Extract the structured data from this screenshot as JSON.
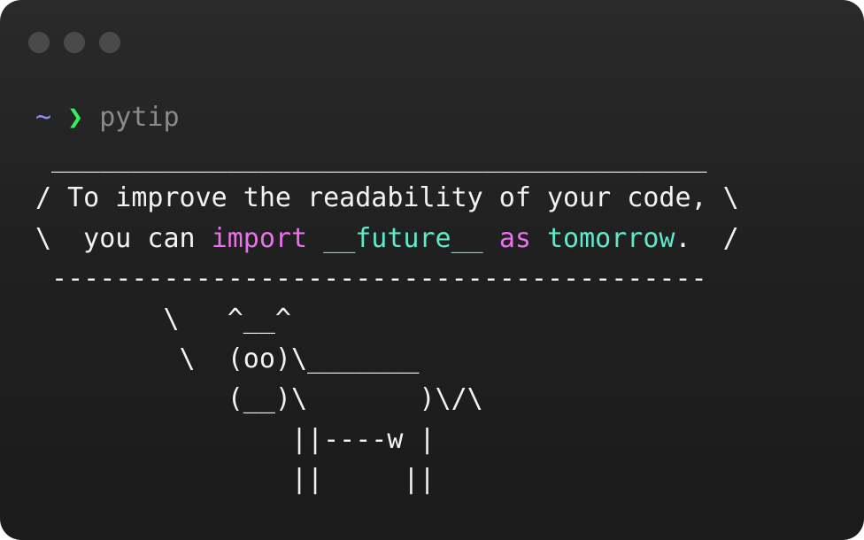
{
  "window": {
    "buttons": [
      "close",
      "minimize",
      "maximize"
    ]
  },
  "prompt": {
    "tilde": "~",
    "chevron": "❯",
    "command": "pytip"
  },
  "output": {
    "top_border": " _________________________________________",
    "line1": "/ To improve the readability of your code, \\",
    "line2_start": "\\  you can ",
    "line2_kw_import": "import",
    "line2_space1": " ",
    "line2_future": "__future__",
    "line2_space2": " ",
    "line2_kw_as": "as",
    "line2_space3": " ",
    "line2_tomorrow": "tomorrow",
    "line2_end": ".  /",
    "bottom_border": " -----------------------------------------",
    "cow": [
      "        \\   ^__^",
      "         \\  (oo)\\_______",
      "            (__)\\       )\\/\\",
      "                ||----w |",
      "                ||     ||"
    ]
  }
}
